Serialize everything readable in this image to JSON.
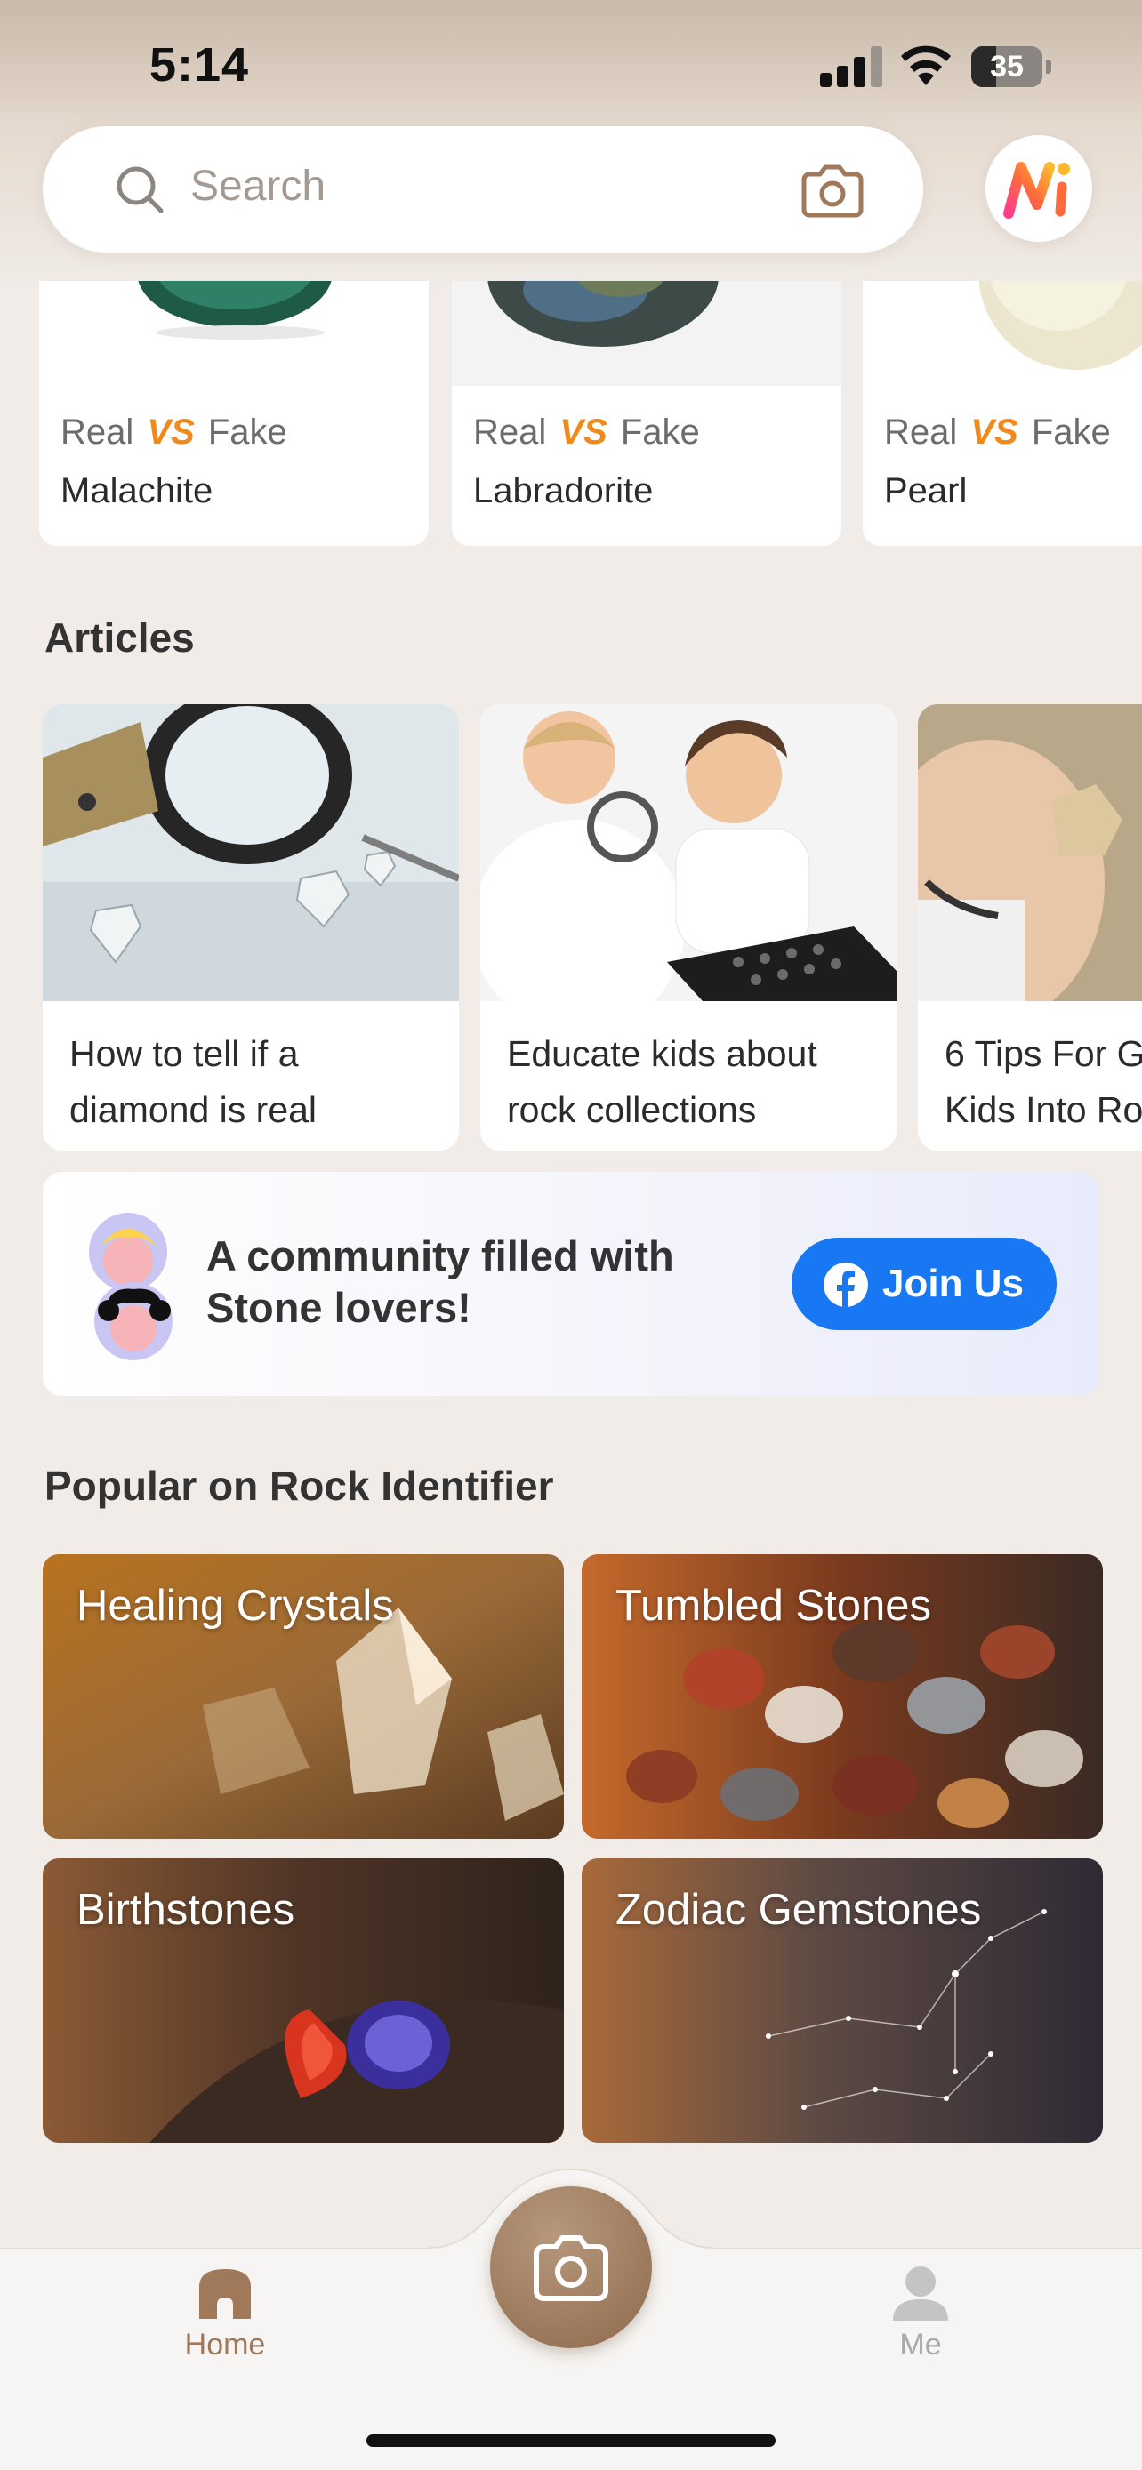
{
  "status_bar": {
    "time": "5:14",
    "battery_level": "35"
  },
  "search": {
    "placeholder": "Search"
  },
  "real_vs_fake": {
    "items": [
      {
        "prefix": "Real",
        "vs": "VS",
        "suffix": "Fake",
        "name": "Malachite"
      },
      {
        "prefix": "Real",
        "vs": "VS",
        "suffix": "Fake",
        "name": "Labradorite"
      },
      {
        "prefix": "Real",
        "vs": "VS",
        "suffix": "Fake",
        "name": "Pearl"
      }
    ]
  },
  "articles": {
    "title": "Articles",
    "items": [
      {
        "title": "How to tell if a\ndiamond is real"
      },
      {
        "title": "Educate kids about\nrock collections"
      },
      {
        "title": "6 Tips For G\nKids Into Ro"
      }
    ]
  },
  "community": {
    "text": "A community filled with Stone lovers!",
    "button_label": "Join Us",
    "button_color": "#1877f2"
  },
  "popular": {
    "title": "Popular on Rock Identifier",
    "tiles": [
      {
        "label": "Healing Crystals"
      },
      {
        "label": "Tumbled Stones"
      },
      {
        "label": "Birthstones"
      },
      {
        "label": "Zodiac Gemstones"
      }
    ]
  },
  "tabbar": {
    "home_label": "Home",
    "me_label": "Me",
    "active_color": "#a0785a",
    "inactive_color": "#a8a8a8"
  }
}
